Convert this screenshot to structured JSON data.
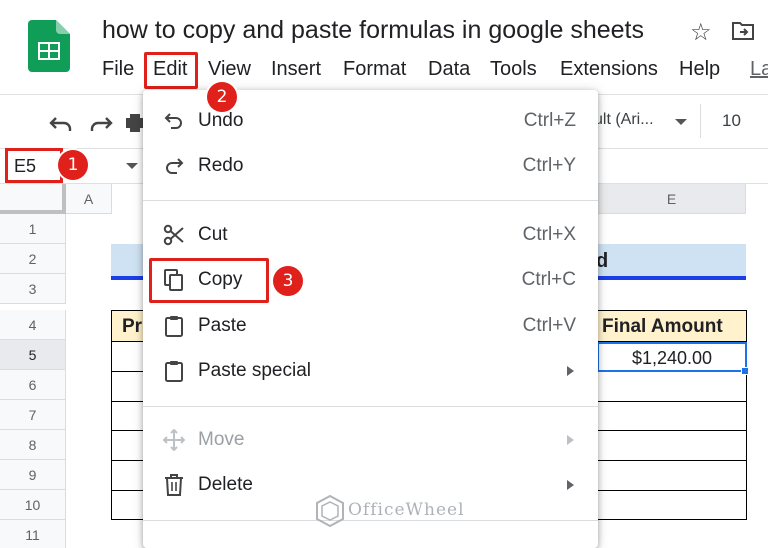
{
  "document": {
    "title": "how to copy and paste formulas in google sheets"
  },
  "menubar": {
    "items": [
      "File",
      "Edit",
      "View",
      "Insert",
      "Format",
      "Data",
      "Tools",
      "Extensions",
      "Help",
      "La"
    ]
  },
  "toolbar": {
    "font_name": "ult (Ari...",
    "font_size": "10"
  },
  "formula_bar": {
    "name_box": "E5"
  },
  "grid": {
    "columns": [
      "A",
      "E"
    ],
    "rows": [
      "1",
      "2",
      "3",
      "4",
      "5",
      "6",
      "7",
      "8",
      "9",
      "10",
      "11"
    ],
    "active_row": "5",
    "title_fragment": "d",
    "header_left_fragment": "Pr",
    "header_right": "Final Amount",
    "cell_e5": "$1,240.00"
  },
  "edit_menu": {
    "items": [
      {
        "icon": "undo-icon",
        "label": "Undo",
        "shortcut": "Ctrl+Z"
      },
      {
        "icon": "redo-icon",
        "label": "Redo",
        "shortcut": "Ctrl+Y"
      },
      {
        "icon": "scissors-icon",
        "label": "Cut",
        "shortcut": "Ctrl+X"
      },
      {
        "icon": "copy-icon",
        "label": "Copy",
        "shortcut": "Ctrl+C"
      },
      {
        "icon": "clipboard-icon",
        "label": "Paste",
        "shortcut": "Ctrl+V"
      },
      {
        "icon": "clipboard-icon",
        "label": "Paste special",
        "shortcut": ""
      },
      {
        "icon": "move-arrows-icon",
        "label": "Move",
        "shortcut": "",
        "disabled": true
      },
      {
        "icon": "trash-icon",
        "label": "Delete",
        "shortcut": ""
      }
    ]
  },
  "annotations": {
    "badges": [
      "1",
      "2",
      "3"
    ],
    "highlight_color": "#e0201b"
  },
  "watermark": {
    "text": "OfficeWheel"
  },
  "colors": {
    "sheets_green": "#0f9d58",
    "selection_blue": "#1a73e8",
    "header_fill": "#fff2cc",
    "title_band": "#cfe2f3"
  }
}
